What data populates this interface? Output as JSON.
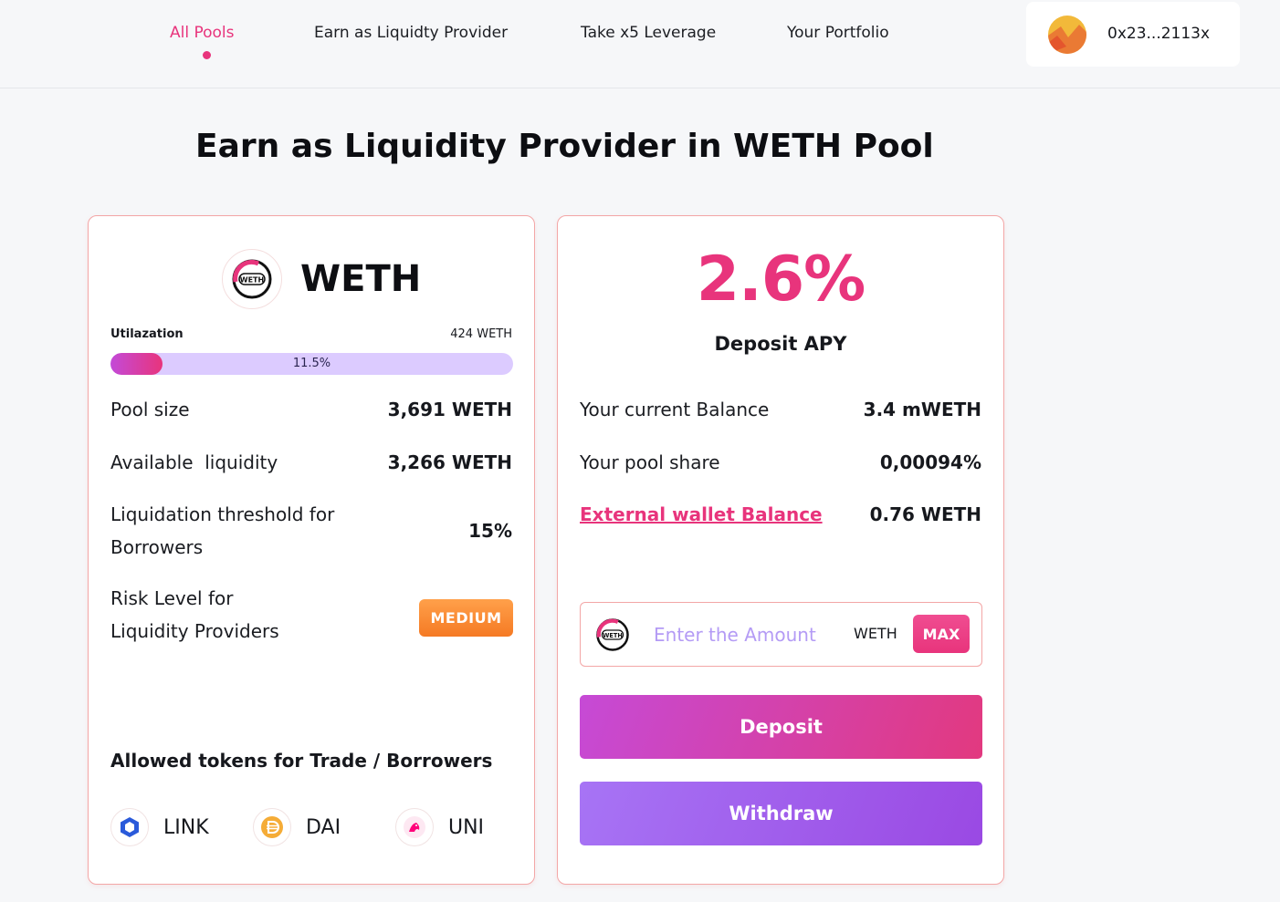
{
  "nav": {
    "items": [
      {
        "label": "All Pools"
      },
      {
        "label": "Earn as Liquidty Provider"
      },
      {
        "label": "Take x5 Leverage"
      },
      {
        "label": "Your Portfolio"
      }
    ],
    "active_index": 0
  },
  "wallet": {
    "address": "0x23...2113x",
    "avatar_icon": "avatar-icon"
  },
  "page": {
    "title": "Earn as Liquidity Provider in WETH Pool"
  },
  "pool": {
    "token": "WETH",
    "token_logo_icon": "weth-icon",
    "utilization_label": "Utilazation",
    "utilization_cap": "424 WETH",
    "utilization_percent": "11.5%",
    "utilization_fraction": 0.13,
    "stats": [
      {
        "label": "Pool size",
        "value": "3,691 WETH"
      },
      {
        "label": "Available  liquidity",
        "value": "3,266 WETH"
      },
      {
        "label": "Liquidation threshold for Borrowers",
        "value": "15%"
      },
      {
        "label": "Risk Level for Liquidity Providers",
        "value": "MEDIUM"
      }
    ],
    "allowed_title": "Allowed tokens for Trade / Borrowers",
    "allowed_tokens": [
      {
        "symbol": "LINK",
        "icon": "link-icon",
        "color": "#2a5ada"
      },
      {
        "symbol": "DAI",
        "icon": "dai-icon",
        "color": "#f5ac37"
      },
      {
        "symbol": "UNI",
        "icon": "uni-icon",
        "color": "#ff007a"
      }
    ]
  },
  "deposit_panel": {
    "apy_value": "2.6%",
    "apy_label": "Deposit APY",
    "rows": [
      {
        "label": "Your current Balance",
        "value": "3.4 mWETH"
      },
      {
        "label": "Your pool share",
        "value": "0,00094%"
      },
      {
        "label": "External wallet Balance",
        "value": "0.76 WETH"
      }
    ],
    "amount_placeholder": "Enter the Amount",
    "amount_unit": "WETH",
    "max_label": "MAX",
    "deposit_label": "Deposit",
    "withdraw_label": "Withdraw"
  },
  "colors": {
    "accent": "#e8347c",
    "risk_medium": "#f57a24",
    "progress_track": "#dccbff",
    "card_border": "#f3a6a6"
  }
}
